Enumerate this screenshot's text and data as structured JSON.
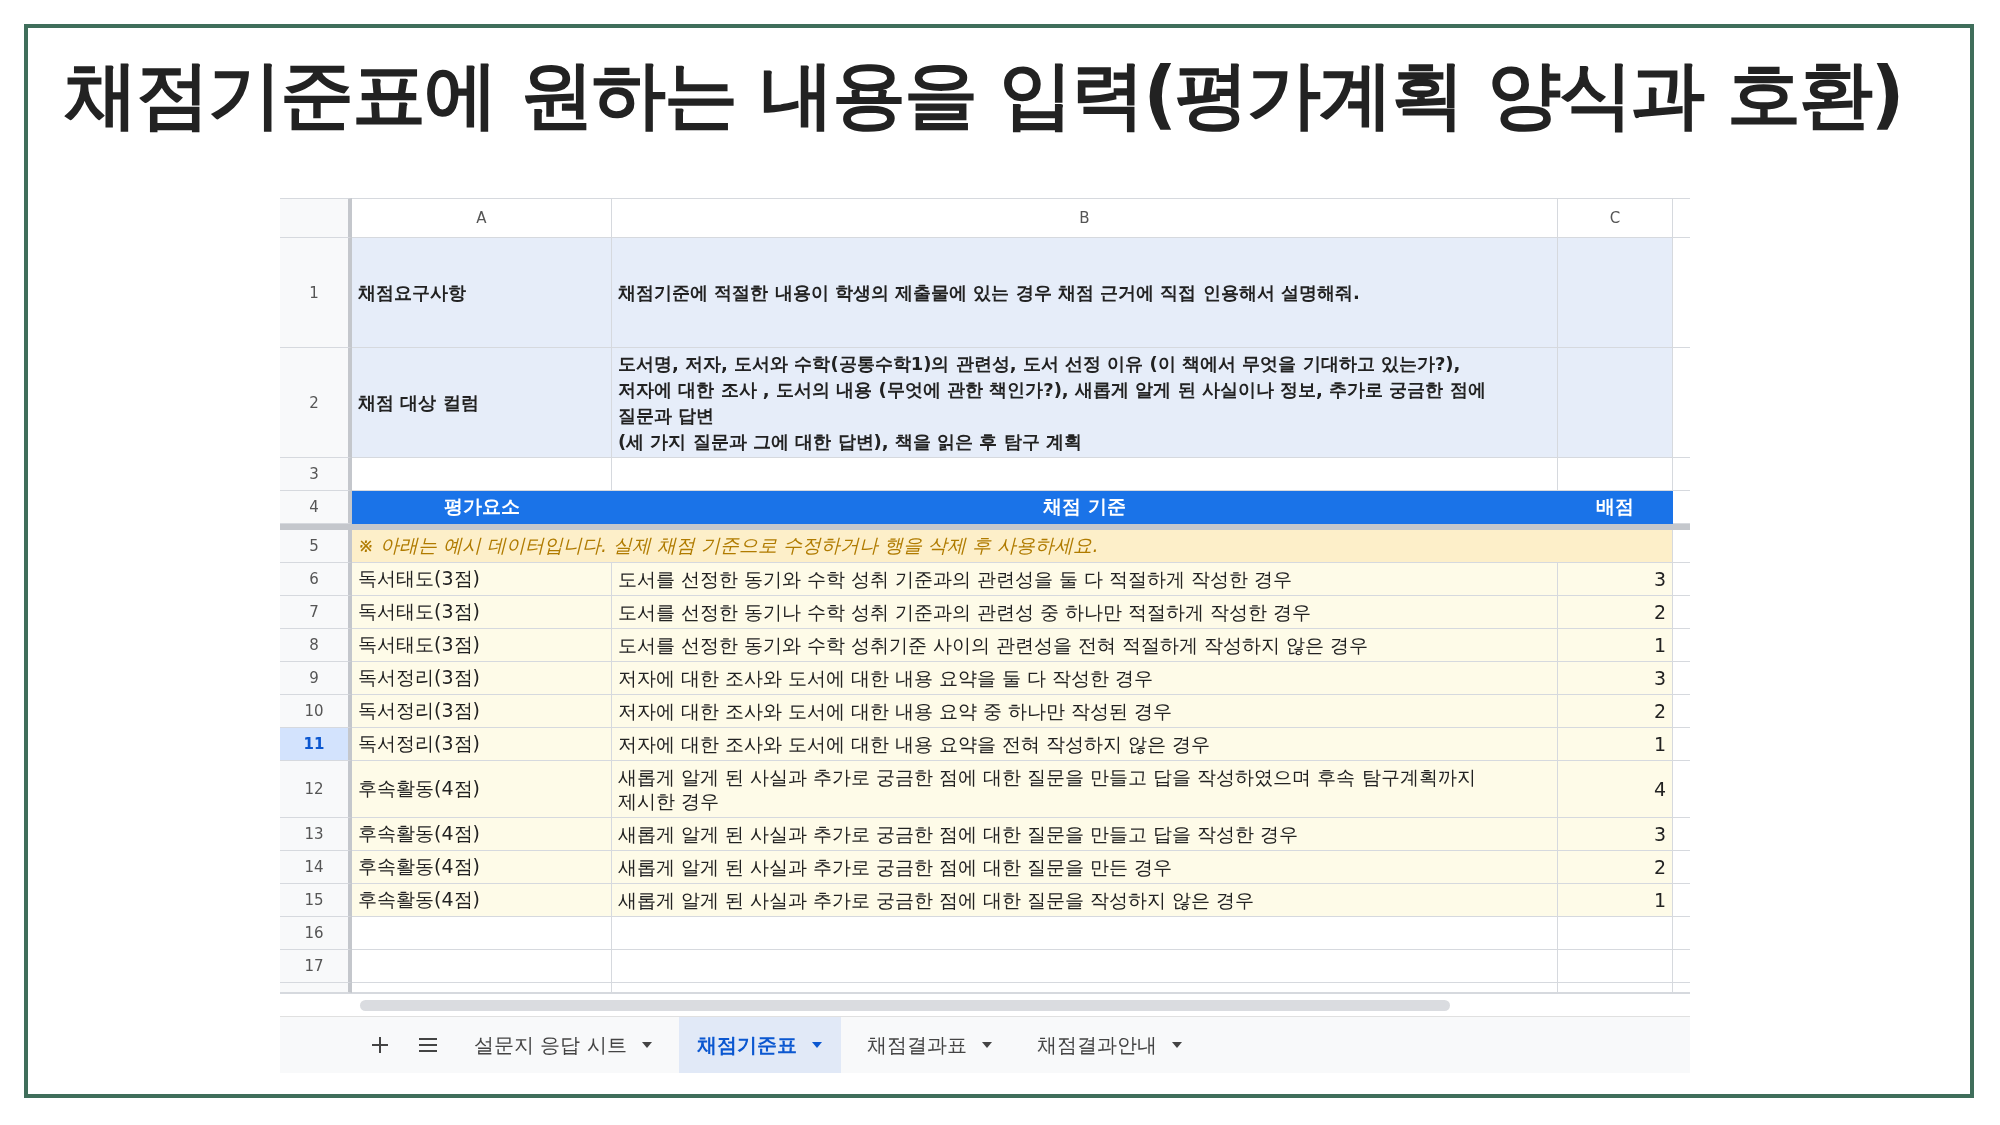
{
  "slide_title": "채점기준표에 원하는 내용을 입력(평가계획 양식과 호환)",
  "sheet": {
    "columns": [
      "A",
      "B",
      "C"
    ],
    "rows": [
      {
        "number": "1",
        "kind": "info",
        "selected": false,
        "cells": [
          "채점요구사항",
          "채점기준에 적절한 내용이 학생의 제출물에 있는 경우 채점 근거에 직접 인용해서 설명해줘."
        ]
      },
      {
        "number": "2",
        "kind": "info",
        "selected": false,
        "cells": [
          "채점 대상 컬럼",
          "도서명, 저자, 도서와 수학(공통수학1)의 관련성, 도서 선정 이유 (이 책에서 무엇을 기대하고 있는가?),\n저자에 대한 조사 , 도서의 내용 (무엇에 관한 책인가?), 새롭게 알게 된 사실이나 정보, 추가로 궁금한 점에\n질문과 답변\n(세 가지 질문과 그에 대한 답변), 책을 읽은 후 탐구 계획"
        ]
      },
      {
        "number": "3",
        "kind": "blank",
        "selected": false,
        "cells": []
      },
      {
        "number": "4",
        "kind": "header",
        "selected": false,
        "cells": [
          "평가요소",
          "채점 기준",
          "배점"
        ]
      },
      {
        "number": "5",
        "kind": "note",
        "selected": false,
        "cells": [
          "※ 아래는 예시 데이터입니다. 실제 채점 기준으로 수정하거나 행을 삭제 후 사용하세요."
        ]
      },
      {
        "number": "6",
        "kind": "data",
        "selected": false,
        "cells": [
          "독서태도(3점)",
          "도서를 선정한 동기와 수학 성취 기준과의 관련성을 둘 다 적절하게 작성한 경우",
          "3"
        ]
      },
      {
        "number": "7",
        "kind": "data",
        "selected": false,
        "cells": [
          "독서태도(3점)",
          "도서를 선정한 동기나 수학 성취 기준과의 관련성 중 하나만 적절하게 작성한 경우",
          "2"
        ]
      },
      {
        "number": "8",
        "kind": "data",
        "selected": false,
        "cells": [
          "독서태도(3점)",
          "도서를 선정한 동기와 수학 성취기준 사이의 관련성을 전혀 적절하게 작성하지 않은 경우",
          "1"
        ]
      },
      {
        "number": "9",
        "kind": "data",
        "selected": false,
        "cells": [
          "독서정리(3점)",
          "저자에 대한 조사와 도서에 대한 내용 요약을 둘 다 작성한 경우",
          "3"
        ]
      },
      {
        "number": "10",
        "kind": "data",
        "selected": false,
        "cells": [
          "독서정리(3점)",
          "저자에 대한 조사와 도서에 대한 내용 요약 중 하나만 작성된 경우",
          "2"
        ]
      },
      {
        "number": "11",
        "kind": "data",
        "selected": true,
        "cells": [
          "독서정리(3점)",
          "저자에 대한 조사와 도서에 대한 내용 요약을 전혀 작성하지 않은 경우",
          "1"
        ]
      },
      {
        "number": "12",
        "kind": "data",
        "selected": false,
        "cells": [
          "후속활동(4점)",
          "새롭게 알게 된 사실과 추가로 궁금한 점에 대한 질문을 만들고 답을 작성하였으며 후속 탐구계획까지\n제시한 경우",
          "4"
        ]
      },
      {
        "number": "13",
        "kind": "data",
        "selected": false,
        "cells": [
          "후속활동(4점)",
          "새롭게 알게 된 사실과 추가로 궁금한 점에 대한 질문을 만들고 답을 작성한 경우",
          "3"
        ]
      },
      {
        "number": "14",
        "kind": "data",
        "selected": false,
        "cells": [
          "후속활동(4점)",
          "새롭게 알게 된 사실과 추가로 궁금한 점에 대한 질문을 만든 경우",
          "2"
        ]
      },
      {
        "number": "15",
        "kind": "data",
        "selected": false,
        "cells": [
          "후속활동(4점)",
          "새롭게 알게 된 사실과 추가로 궁금한 점에 대한 질문을 작성하지 않은 경우",
          "1"
        ]
      },
      {
        "number": "16",
        "kind": "blank",
        "selected": false,
        "cells": []
      },
      {
        "number": "17",
        "kind": "blank",
        "selected": false,
        "cells": []
      }
    ]
  },
  "tabs": [
    {
      "label": "설문지 응답 시트",
      "selected": false
    },
    {
      "label": "채점기준표",
      "selected": true
    },
    {
      "label": "채점결과표",
      "selected": false
    },
    {
      "label": "채점결과안내",
      "selected": false
    }
  ]
}
